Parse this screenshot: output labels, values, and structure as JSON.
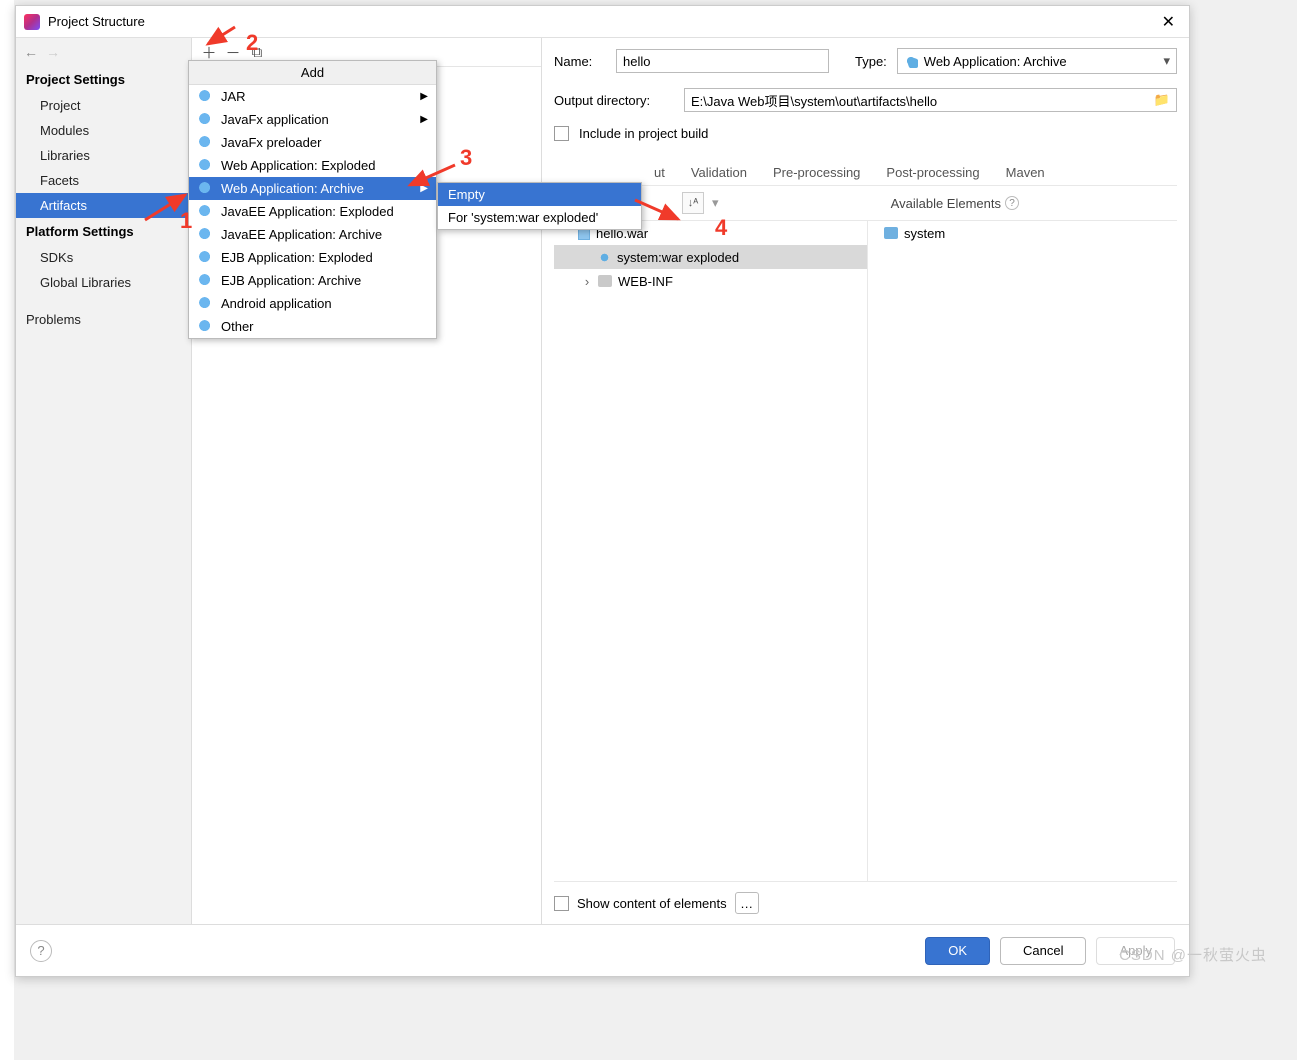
{
  "window": {
    "title": "Project Structure"
  },
  "sidebar": {
    "section1": "Project Settings",
    "items1": [
      "Project",
      "Modules",
      "Libraries",
      "Facets",
      "Artifacts"
    ],
    "section2": "Platform Settings",
    "items2": [
      "SDKs",
      "Global Libraries"
    ],
    "section3": "",
    "items3": [
      "Problems"
    ]
  },
  "addMenu": {
    "header": "Add",
    "items": [
      {
        "label": "JAR",
        "sub": true
      },
      {
        "label": "JavaFx application",
        "sub": true
      },
      {
        "label": "JavaFx preloader",
        "sub": false
      },
      {
        "label": "Web Application: Exploded",
        "sub": false
      },
      {
        "label": "Web Application: Archive",
        "sub": true,
        "hl": true
      },
      {
        "label": "JavaEE Application: Exploded",
        "sub": false
      },
      {
        "label": "JavaEE Application: Archive",
        "sub": false
      },
      {
        "label": "EJB Application: Exploded",
        "sub": false
      },
      {
        "label": "EJB Application: Archive",
        "sub": false
      },
      {
        "label": "Android application",
        "sub": false
      },
      {
        "label": "Other",
        "sub": false
      }
    ]
  },
  "subMenu": {
    "items": [
      {
        "label": "Empty",
        "hl": true
      },
      {
        "label": "For 'system:war exploded'",
        "hl": false
      }
    ]
  },
  "form": {
    "nameLabel": "Name:",
    "nameValue": "hello",
    "typeLabel": "Type:",
    "typeValue": "Web Application: Archive",
    "outDirLabel": "Output directory:",
    "outDirValue": "E:\\Java Web项目\\system\\out\\artifacts\\hello",
    "includeLabel": "Include in project build"
  },
  "tabs": [
    "ut",
    "Validation",
    "Pre-processing",
    "Post-processing",
    "Maven"
  ],
  "availableLabel": "Available Elements",
  "tree": {
    "root": "hello.war",
    "child1": "system:war exploded",
    "child2": "WEB-INF"
  },
  "avail": {
    "item": "system"
  },
  "footerOpt": {
    "label": "Show content of elements"
  },
  "buttons": {
    "ok": "OK",
    "cancel": "Cancel",
    "apply": "Apply"
  },
  "annotations": {
    "a1": "1",
    "a2": "2",
    "a3": "3",
    "a4": "4"
  },
  "watermark": "CSDN @一秋萤火虫"
}
